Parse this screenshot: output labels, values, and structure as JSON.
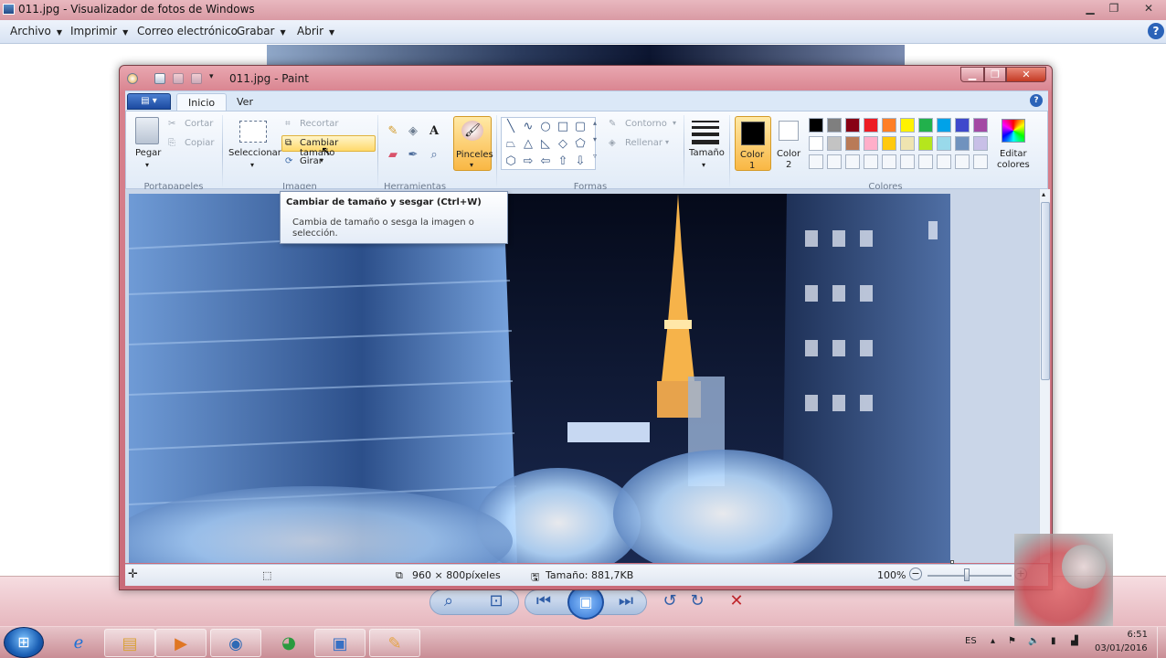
{
  "photo_viewer": {
    "title": "011.jpg - Visualizador de fotos de Windows",
    "menu": [
      {
        "label": "Archivo"
      },
      {
        "label": "Imprimir"
      },
      {
        "label": "Correo electrónico"
      },
      {
        "label": "Grabar"
      },
      {
        "label": "Abrir"
      }
    ],
    "help_label": "?"
  },
  "paint": {
    "title": "011.jpg - Paint",
    "tabs": {
      "inicio": "Inicio",
      "ver": "Ver"
    },
    "ribbon": {
      "pegar": "Pegar",
      "cortar": "Cortar",
      "copiar": "Copiar",
      "portapapeles": "Portapapeles",
      "seleccionar": "Seleccionar",
      "recortar": "Recortar",
      "cambiar_tamano": "Cambiar tamaño",
      "girar": "Girar",
      "imagen": "Imagen",
      "herramientas": "Herramientas",
      "pinceles": "Pinceles",
      "formas": "Formas",
      "contorno": "Contorno",
      "rellenar": "Rellenar",
      "tamano": "Tamaño",
      "color1": "Color",
      "color1_num": "1",
      "color2": "Color",
      "color2_num": "2",
      "editar_colores_1": "Editar",
      "editar_colores_2": "colores",
      "colores": "Colores"
    },
    "palette_row1": [
      "#000000",
      "#7f7f7f",
      "#880015",
      "#ed1c24",
      "#ff7f27",
      "#fff200",
      "#22b14c",
      "#00a2e8",
      "#3f48cc",
      "#a349a4"
    ],
    "palette_row2": [
      "#ffffff",
      "#c3c3c3",
      "#b97a57",
      "#ffaec9",
      "#ffc90e",
      "#efe4b0",
      "#b5e61d",
      "#99d9ea",
      "#7092be",
      "#c8bfe7"
    ],
    "tooltip": {
      "title": "Cambiar de tamaño y sesgar (Ctrl+W)",
      "description": "Cambia de tamaño o sesga la imagen o selección."
    },
    "status": {
      "dimensions": "960 × 800píxeles",
      "size": "Tamaño: 881,7KB",
      "zoom": "100%"
    }
  },
  "taskbar": {
    "language": "ES",
    "time": "6:51",
    "date": "03/01/2016"
  }
}
